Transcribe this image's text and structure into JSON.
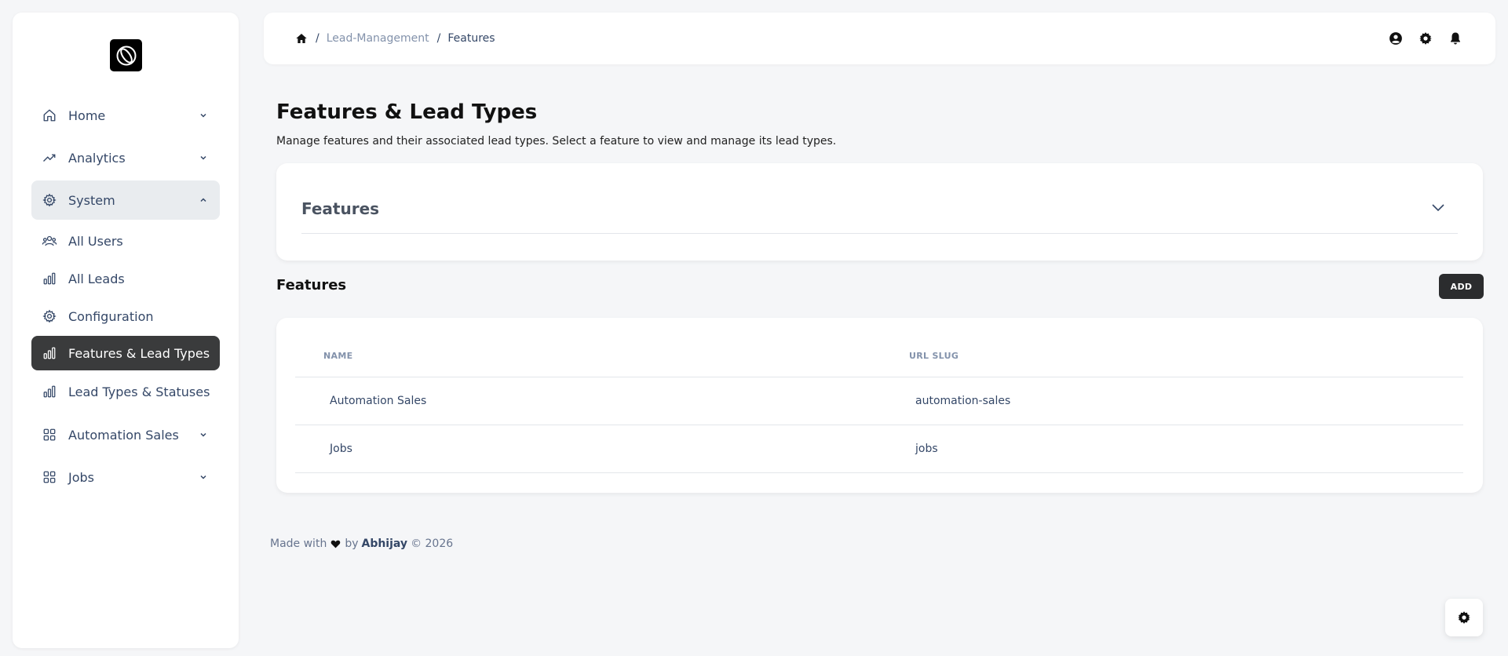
{
  "sidebar": {
    "items": [
      {
        "label": "Home",
        "icon": "home-icon",
        "chevron": "down"
      },
      {
        "label": "Analytics",
        "icon": "trending-icon",
        "chevron": "down"
      },
      {
        "label": "System",
        "icon": "gear-icon",
        "chevron": "up"
      },
      {
        "label": "All Users",
        "icon": "users-icon"
      },
      {
        "label": "All Leads",
        "icon": "bar-chart-icon"
      },
      {
        "label": "Configuration",
        "icon": "gear-icon"
      },
      {
        "label": "Features & Lead Types",
        "icon": "bar-chart-icon",
        "active": true
      },
      {
        "label": "Lead Types & Statuses",
        "icon": "bar-chart-icon"
      },
      {
        "label": "Automation Sales",
        "icon": "grid-icon",
        "chevron": "down"
      },
      {
        "label": "Jobs",
        "icon": "grid-icon",
        "chevron": "down"
      }
    ]
  },
  "breadcrumb": {
    "parent": "Lead-Management",
    "current": "Features"
  },
  "page": {
    "title": "Features & Lead Types",
    "subtitle": "Manage features and their associated lead types. Select a feature to view and manage its lead types."
  },
  "accordion": {
    "title": "Features"
  },
  "features_section": {
    "title": "Features",
    "add_label": "ADD",
    "columns": [
      "NAME",
      "URL SLUG"
    ],
    "rows": [
      {
        "name": "Automation Sales",
        "slug": "automation-sales"
      },
      {
        "name": "Jobs",
        "slug": "jobs"
      }
    ]
  },
  "footer": {
    "made_with": "Made with",
    "by": "by",
    "author": "Abhijay",
    "copyright": "© 2026"
  },
  "colors": {
    "active_nav": "#3a3b3c",
    "page_bg": "#f5f6f8",
    "button_dark": "#2b2c2e"
  }
}
